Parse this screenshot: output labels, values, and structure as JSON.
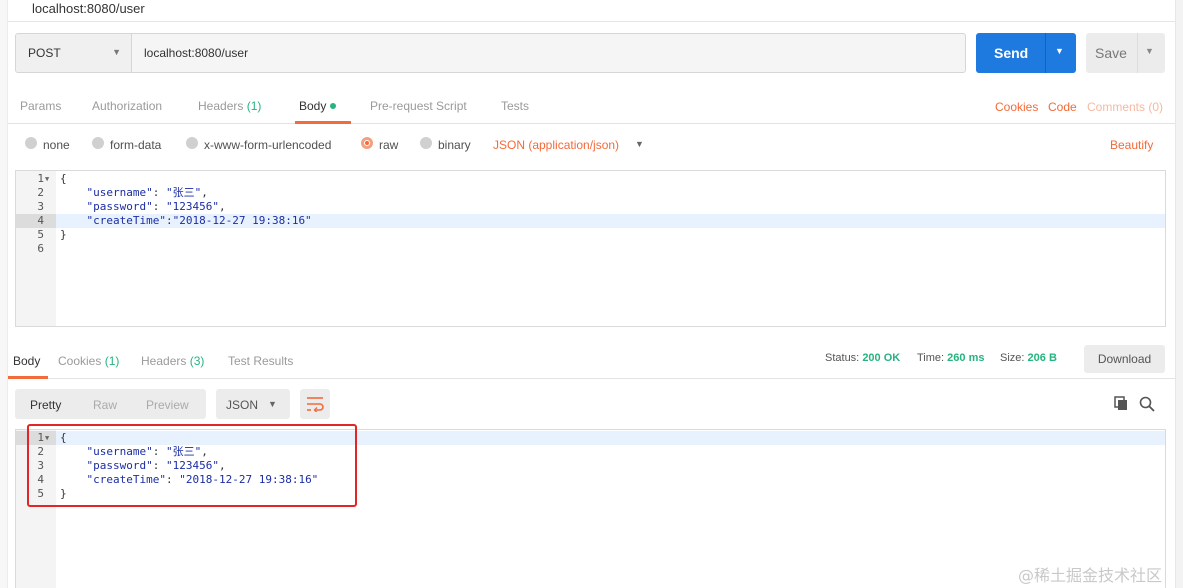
{
  "window": {
    "tab_title": "localhost:8080/user"
  },
  "request": {
    "method": "POST",
    "url": "localhost:8080/user",
    "send_label": "Send",
    "save_label": "Save"
  },
  "request_tabs": {
    "params": "Params",
    "authorization": "Authorization",
    "headers": "Headers",
    "headers_count": "(1)",
    "body": "Body",
    "prerequest": "Pre-request Script",
    "tests": "Tests",
    "cookies": "Cookies",
    "code": "Code",
    "comments": "Comments (0)"
  },
  "body_options": {
    "none": "none",
    "form_data": "form-data",
    "urlencoded": "x-www-form-urlencoded",
    "raw": "raw",
    "binary": "binary",
    "content_type": "JSON (application/json)",
    "beautify": "Beautify"
  },
  "request_body_lines": [
    {
      "n": "1",
      "text": "{"
    },
    {
      "n": "2",
      "key": "\"username\"",
      "sep": ": ",
      "val": "\"张三\"",
      "end": ","
    },
    {
      "n": "3",
      "key": "\"password\"",
      "sep": ": ",
      "val": "\"123456\"",
      "end": ","
    },
    {
      "n": "4",
      "key": "\"createTime\"",
      "sep": ":",
      "val": "\"2018-12-27 19:38:16\"",
      "end": ""
    },
    {
      "n": "5",
      "text": "}"
    },
    {
      "n": "6",
      "text": ""
    }
  ],
  "response_tabs": {
    "body": "Body",
    "cookies": "Cookies",
    "cookies_count": "(1)",
    "headers": "Headers",
    "headers_count": "(3)",
    "test_results": "Test Results"
  },
  "response_status": {
    "status_label": "Status:",
    "status_value": "200 OK",
    "time_label": "Time:",
    "time_value": "260 ms",
    "size_label": "Size:",
    "size_value": "206 B",
    "download_label": "Download"
  },
  "response_view": {
    "pretty": "Pretty",
    "raw": "Raw",
    "preview": "Preview",
    "format": "JSON"
  },
  "response_body_lines": [
    {
      "n": "1",
      "text": "{"
    },
    {
      "n": "2",
      "key": "\"username\"",
      "sep": ": ",
      "val": "\"张三\"",
      "end": ","
    },
    {
      "n": "3",
      "key": "\"password\"",
      "sep": ": ",
      "val": "\"123456\"",
      "end": ","
    },
    {
      "n": "4",
      "key": "\"createTime\"",
      "sep": ": ",
      "val": "\"2018-12-27 19:38:16\"",
      "end": ""
    },
    {
      "n": "5",
      "text": "}"
    }
  ],
  "watermark": "@稀土掘金技术社区",
  "colors": {
    "accent": "#f26b3a",
    "send": "#1f7ae0",
    "status_ok": "#26b47f",
    "highlight_box": "#e22525"
  }
}
